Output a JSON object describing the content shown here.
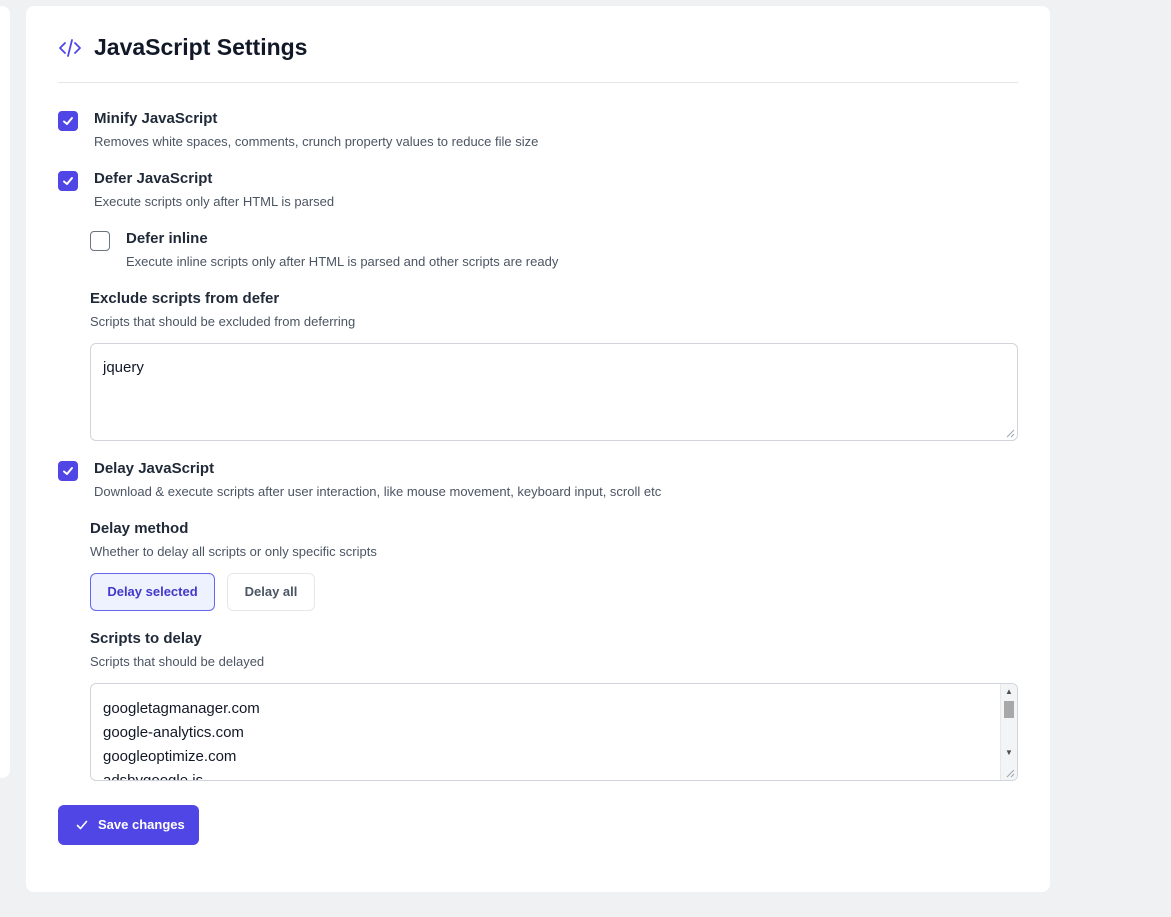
{
  "header": {
    "title": "JavaScript Settings",
    "icon": "code-icon",
    "accent_color": "#4f46e5"
  },
  "options": {
    "minify": {
      "label": "Minify JavaScript",
      "description": "Removes white spaces, comments, crunch property values to reduce file size",
      "checked": true
    },
    "defer": {
      "label": "Defer JavaScript",
      "description": "Execute scripts only after HTML is parsed",
      "checked": true
    },
    "defer_inline": {
      "label": "Defer inline",
      "description": "Execute inline scripts only after HTML is parsed and other scripts are ready",
      "checked": false
    },
    "exclude_defer": {
      "label": "Exclude scripts from defer",
      "description": "Scripts that should be excluded from deferring",
      "value": "jquery"
    },
    "delay": {
      "label": "Delay JavaScript",
      "description": "Download & execute scripts after user interaction, like mouse movement, keyboard input, scroll etc",
      "checked": true
    },
    "delay_method": {
      "label": "Delay method",
      "description": "Whether to delay all scripts or only specific scripts",
      "options": [
        "Delay selected",
        "Delay all"
      ],
      "selected": "Delay selected"
    },
    "scripts_to_delay": {
      "label": "Scripts to delay",
      "description": "Scripts that should be delayed",
      "value": "googletagmanager.com\ngoogle-analytics.com\ngoogleoptimize.com\nadsbygoogle.js"
    }
  },
  "footer": {
    "save_label": "Save changes"
  }
}
